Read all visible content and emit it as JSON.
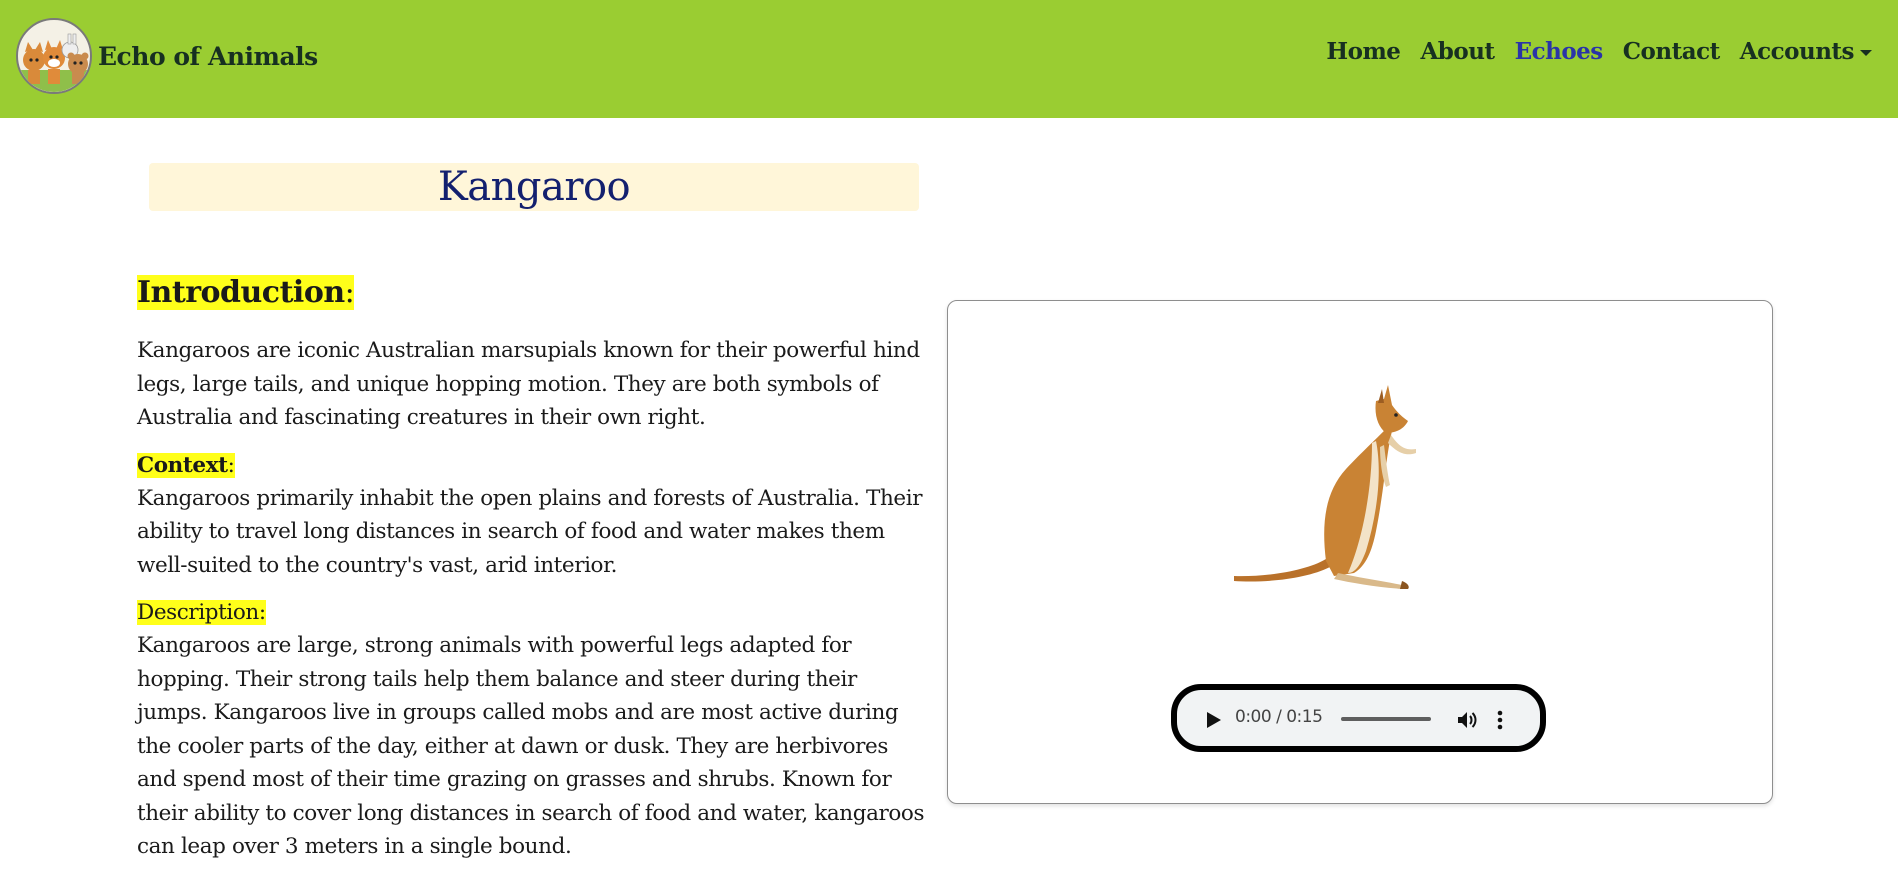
{
  "brand": {
    "name": "Echo of Animals",
    "logo_icon": "animal-group-logo-icon"
  },
  "nav": {
    "items": [
      {
        "label": "Home",
        "active": false
      },
      {
        "label": "About",
        "active": false
      },
      {
        "label": "Echoes",
        "active": true
      },
      {
        "label": "Contact",
        "active": false
      },
      {
        "label": "Accounts",
        "active": false,
        "dropdown": true
      }
    ]
  },
  "page": {
    "title": "Kangaroo"
  },
  "sections": {
    "introduction": {
      "heading": "Introduction",
      "colon": ":",
      "text": "Kangaroos are iconic Australian marsupials known for their powerful hind legs, large tails, and unique hopping motion. They are both symbols of Australia and fascinating creatures in their own right."
    },
    "context": {
      "heading": "Context",
      "colon": ":",
      "text": "Kangaroos primarily inhabit the open plains and forests of Australia. Their ability to travel long distances in search of food and water makes them well-suited to the country's vast, arid interior."
    },
    "description": {
      "heading": "Description:",
      "text": "Kangaroos are large, strong animals with powerful legs adapted for hopping. Their strong tails help them balance and steer during their jumps. Kangaroos live in groups called mobs and are most active during the cooler parts of the day, either at dawn or dusk. They are herbivores and spend most of their time grazing on grasses and shrubs. Known for their ability to cover long distances in search of food and water, kangaroos can leap over 3 meters in a single bound."
    }
  },
  "media": {
    "image_icon": "kangaroo-illustration",
    "audio": {
      "time": "0:00 / 0:15",
      "progress": 0
    }
  },
  "colors": {
    "navbar": "#9acd32",
    "nav_text": "#173021",
    "nav_active": "#2a34a8",
    "title_bg": "#fff6d9",
    "title_text": "#13206f",
    "highlight": "#ffff1a"
  }
}
